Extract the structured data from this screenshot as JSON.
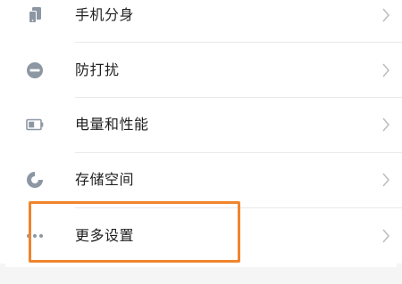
{
  "settings_list": {
    "items": [
      {
        "id": "phone-clone",
        "label": "手机分身",
        "icon": "phone-clone-icon"
      },
      {
        "id": "do-not-disturb",
        "label": "防打扰",
        "icon": "do-not-disturb-icon"
      },
      {
        "id": "battery-performance",
        "label": "电量和性能",
        "icon": "battery-icon"
      },
      {
        "id": "storage",
        "label": "存储空间",
        "icon": "storage-pie-icon"
      },
      {
        "id": "more-settings",
        "label": "更多设置",
        "icon": "more-dots-icon"
      }
    ]
  },
  "colors": {
    "icon": "#8d97a3",
    "label": "#1f1f1f",
    "chevron": "#bcbcbc",
    "divider": "#e9e9e9",
    "highlight": "#f0842c"
  },
  "highlight": {
    "target": "more-settings"
  }
}
